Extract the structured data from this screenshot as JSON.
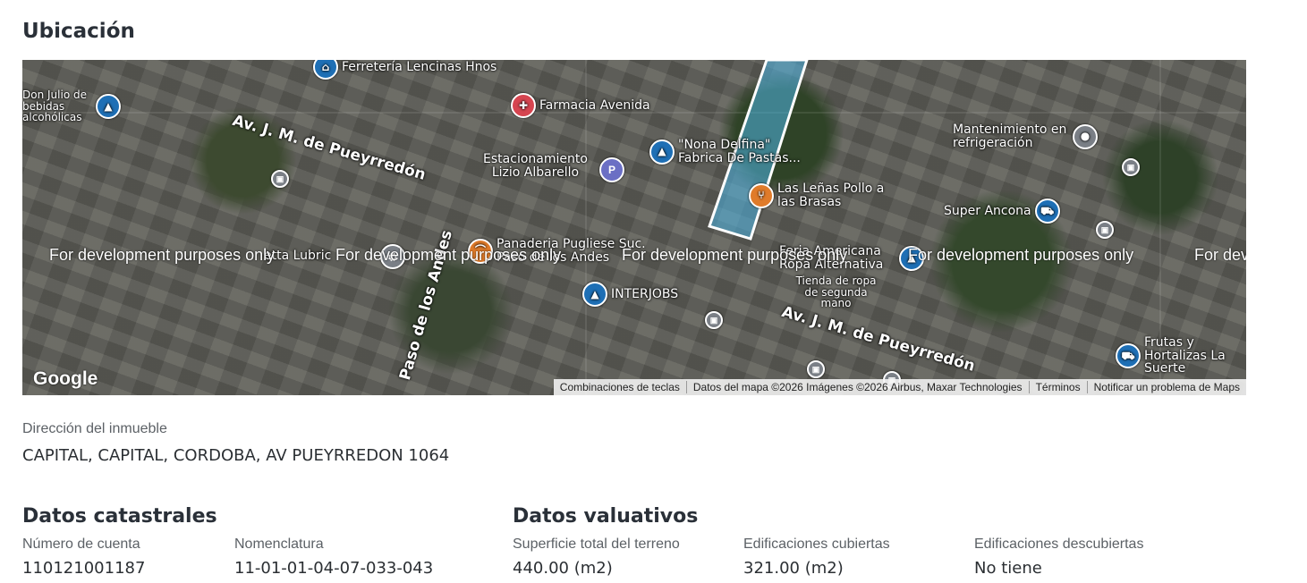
{
  "section_title": "Ubicación",
  "map": {
    "roads": [
      "Av. J. M. de Pueyrredón",
      "Av. J. M. de Pueyrredón",
      "Paso de los Andes"
    ],
    "pois": {
      "ferreteria": "Ferretería Lencinas Hnos",
      "don_julio": "Don Julio de bebidas alcohólicas",
      "farmacia": "Farmacia Avenida",
      "estacionamiento": "Estacionamiento Lizio Albarello",
      "nona_delfina": "\"Nona Delfina\" Fabrica De Pastas...",
      "mantenimiento": "Mantenimiento en refrigeración",
      "las_lenas": "Las Leñas Pollo a las Brasas",
      "super_ancona": "Super Ancona",
      "panaderia": "Panaderia Pugliese Suc. Paso de los Andes",
      "feria": "Feria Americana Ropa Alternativa",
      "tienda": "Tienda de ropa de segunda mano",
      "interjobs": "INTERJOBS",
      "lubric": "etta Lubric",
      "frutas": "Frutas y Hortalizas La Suerte"
    },
    "watermark": "For development purposes only",
    "google_logo": "Google",
    "attribution": {
      "shortcuts": "Combinaciones de teclas",
      "data": "Datos del mapa ©2026 Imágenes ©2026 Airbus, Maxar Technologies",
      "terms": "Términos",
      "report": "Notificar un problema de Maps"
    }
  },
  "address": {
    "label": "Dirección del inmueble",
    "value": "CAPITAL, CAPITAL, CORDOBA, AV PUEYRREDON 1064"
  },
  "catastral": {
    "title": "Datos catastrales",
    "account_label": "Número de cuenta",
    "account_value": "110121001187",
    "nomenclature_label": "Nomenclatura",
    "nomenclature_value": "11-01-01-04-07-033-043"
  },
  "valuativos": {
    "title": "Datos valuativos",
    "land_label": "Superficie total del terreno",
    "land_value": "440.00 (m2)",
    "covered_label": "Edificaciones cubiertas",
    "covered_value": "321.00 (m2)",
    "uncovered_label": "Edificaciones descubiertas",
    "uncovered_value": "No tiene"
  },
  "colors": {
    "parcel": "#4fb6e6",
    "pin_blue": "#1e6fb5"
  }
}
